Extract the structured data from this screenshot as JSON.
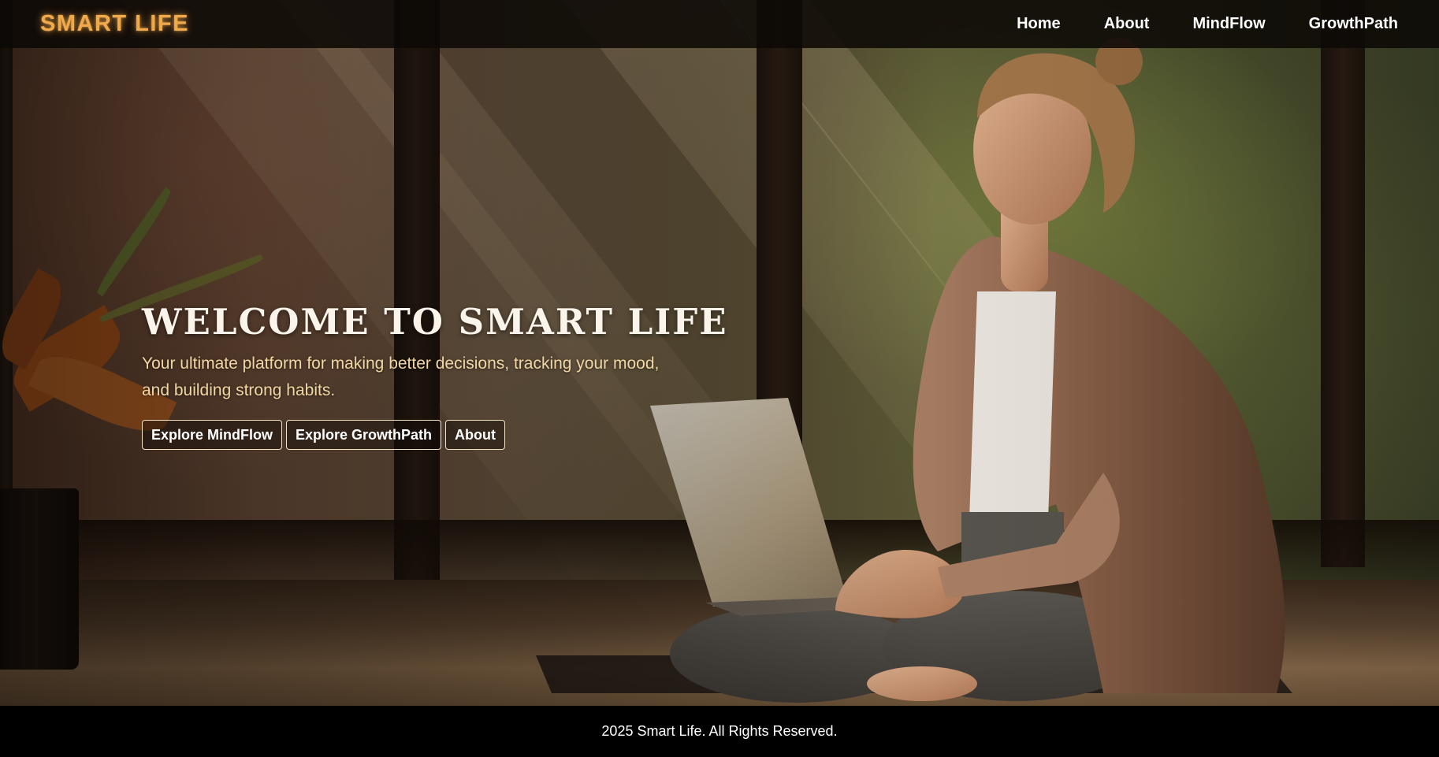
{
  "brand": {
    "name": "SMART LIFE"
  },
  "nav": {
    "items": [
      {
        "label": "Home"
      },
      {
        "label": "About"
      },
      {
        "label": "MindFlow"
      },
      {
        "label": "GrowthPath"
      }
    ]
  },
  "hero": {
    "title": "WELCOME TO SMART LIFE",
    "subtitle": "Your ultimate platform for making better decisions, tracking your mood, and building strong habits.",
    "buttons": [
      {
        "label": "Explore MindFlow"
      },
      {
        "label": "Explore GrowthPath"
      },
      {
        "label": "About"
      }
    ]
  },
  "footer": {
    "text": "2025 Smart Life. All Rights Reserved."
  },
  "colors": {
    "brand_accent": "#f0a94b",
    "subtitle": "#f2d7a4",
    "header_bg": "#0c0906",
    "footer_bg": "#000000"
  }
}
